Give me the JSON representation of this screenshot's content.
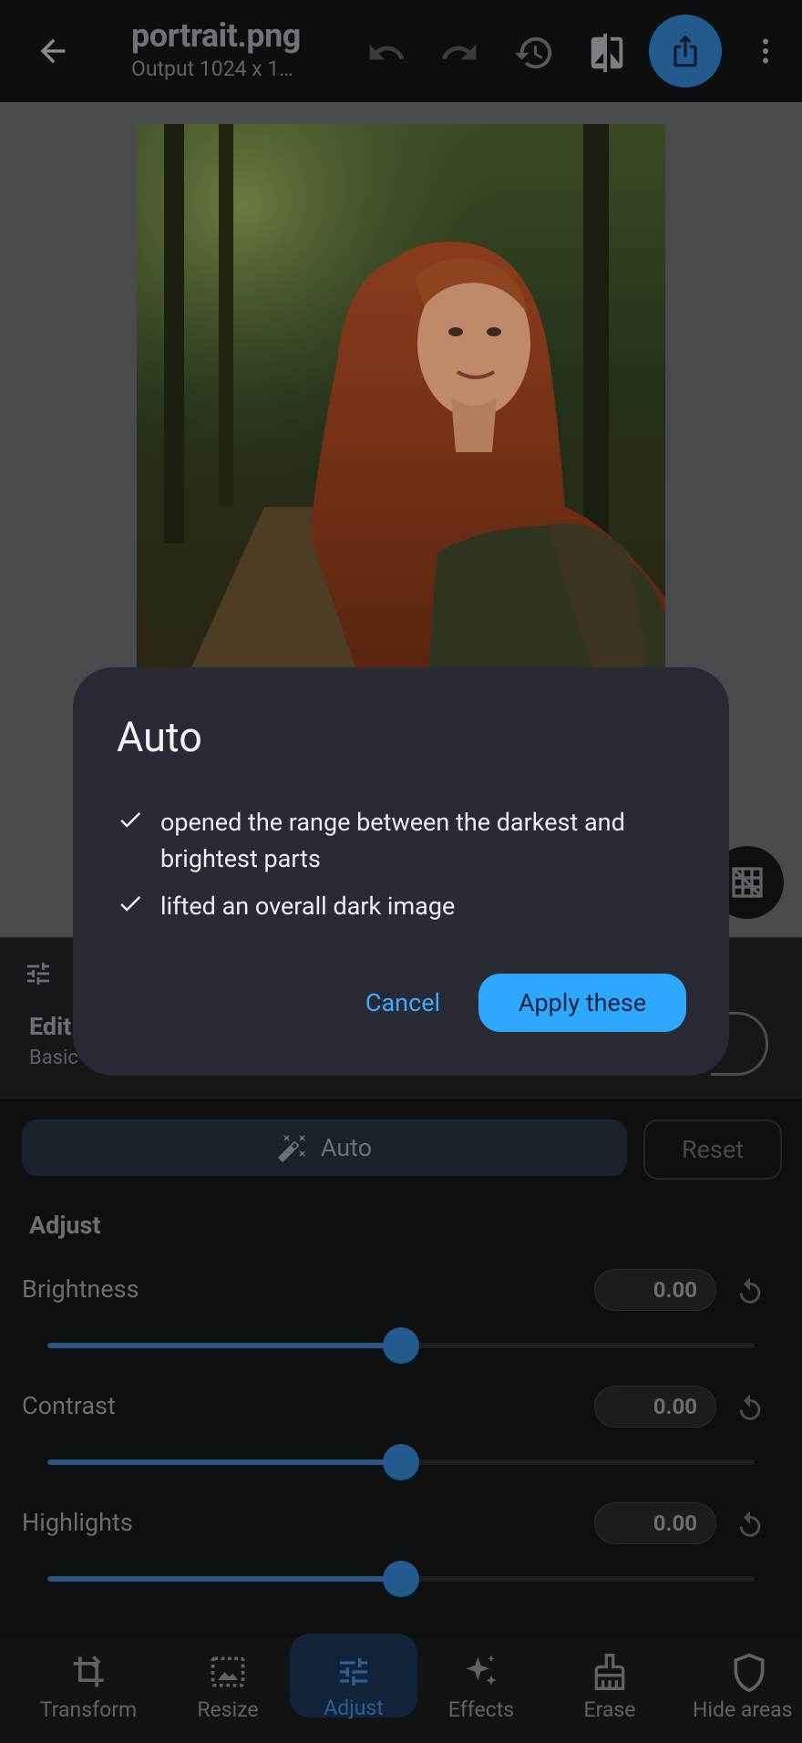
{
  "header": {
    "title": "portrait.png",
    "subtitle": "Output 1024 x 1…"
  },
  "panel": {
    "edit_label": "Edit",
    "basic_label": "Basic",
    "auto_label": "Auto",
    "reset_label": "Reset",
    "adjust_heading": "Adjust",
    "sliders": [
      {
        "label": "Brightness",
        "value": "0.00",
        "fraction": 0.5
      },
      {
        "label": "Contrast",
        "value": "0.00",
        "fraction": 0.5
      },
      {
        "label": "Highlights",
        "value": "0.00",
        "fraction": 0.5
      }
    ]
  },
  "nav": {
    "items": [
      {
        "label": "Transform",
        "icon": "transform-icon"
      },
      {
        "label": "Resize",
        "icon": "resize-icon"
      },
      {
        "label": "Adjust",
        "icon": "adjust-icon",
        "active": true
      },
      {
        "label": "Effects",
        "icon": "effects-icon"
      },
      {
        "label": "Erase",
        "icon": "erase-icon"
      },
      {
        "label": "Hide areas",
        "icon": "shield-icon"
      }
    ]
  },
  "dialog": {
    "title": "Auto",
    "items": [
      "opened the range between the darkest and brightest parts",
      "lifted an overall dark image"
    ],
    "cancel_label": "Cancel",
    "apply_label": "Apply these"
  },
  "colors": {
    "accent": "#2ea8ff",
    "dialog_bg": "#282b33",
    "share_bg": "#24598e"
  }
}
